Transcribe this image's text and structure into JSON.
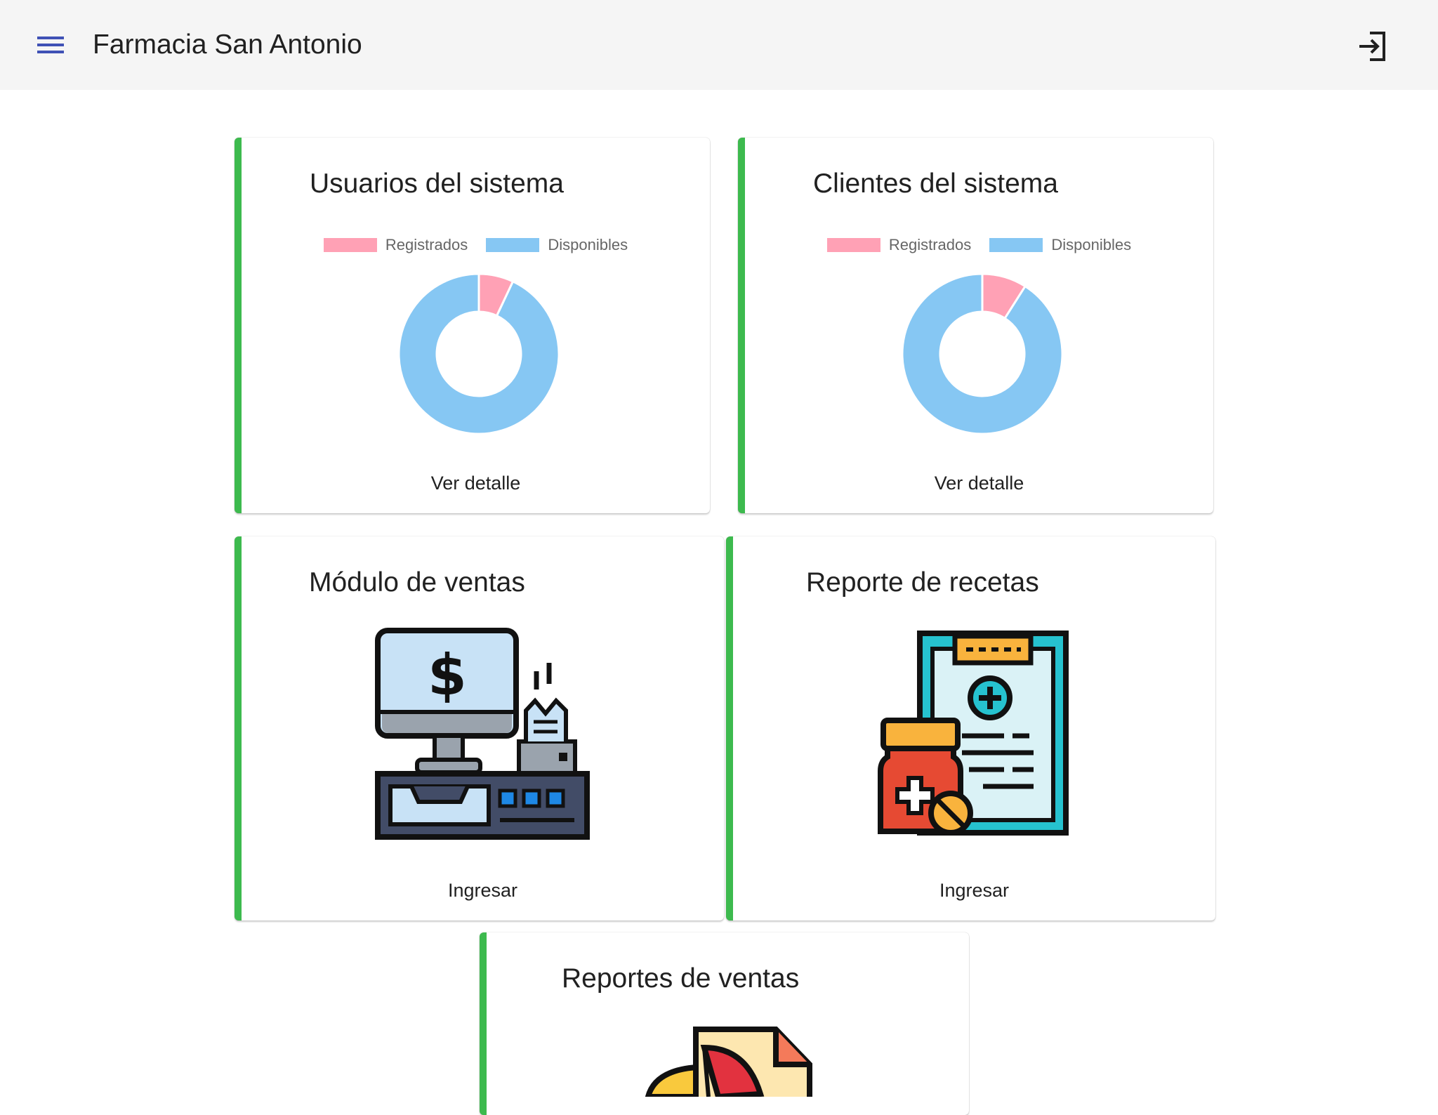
{
  "app": {
    "title": "Farmacia San Antonio",
    "menu_icon": "menu-icon",
    "logout_icon": "login-icon"
  },
  "colors": {
    "accent_bar": "#3dba4e",
    "registrados": "#ffa1b5",
    "disponibles": "#86c7f3"
  },
  "cards": {
    "usuarios": {
      "title": "Usuarios del sistema",
      "action": "Ver detalle",
      "legend": [
        "Registrados",
        "Disponibles"
      ]
    },
    "clientes": {
      "title": "Clientes del sistema",
      "action": "Ver detalle",
      "legend": [
        "Registrados",
        "Disponibles"
      ]
    },
    "ventas": {
      "title": "Módulo de ventas",
      "action": "Ingresar",
      "icon": "cash-register-icon"
    },
    "recetas": {
      "title": "Reporte de recetas",
      "action": "Ingresar",
      "icon": "prescription-clipboard-icon"
    },
    "reportes_ventas": {
      "title": "Reportes de ventas",
      "icon": "pie-chart-report-icon"
    }
  },
  "chart_data": [
    {
      "type": "pie",
      "categories": [
        "Registrados",
        "Disponibles"
      ],
      "values": [
        7,
        93
      ],
      "doughnut": true,
      "legend": "top"
    },
    {
      "type": "pie",
      "categories": [
        "Registrados",
        "Disponibles"
      ],
      "values": [
        9,
        91
      ],
      "doughnut": true,
      "legend": "top"
    }
  ]
}
